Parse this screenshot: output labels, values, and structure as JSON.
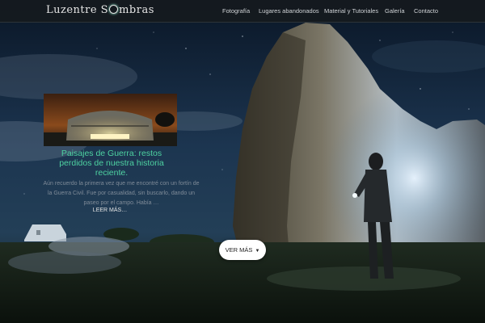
{
  "header": {
    "logo_prefix": "Luzentre S",
    "logo_suffix": "mbras",
    "nav": [
      {
        "label": "Fotografía"
      },
      {
        "label": "Lugares abandonados"
      },
      {
        "label": "Material y Tutoriales"
      },
      {
        "label": "Galería"
      },
      {
        "label": "Contacto"
      }
    ]
  },
  "featured_post": {
    "title": "Paisajes de Guerra: restos perdidos de nuestra historia reciente.",
    "excerpt": "Aún recuerdo la primera vez que me encontré con un fortín de la Guerra Civil. Fue por casualidad, sin buscarlo, dando un paseo por el campo. Había …",
    "read_more": "LEER MÁS…"
  },
  "hero": {
    "button_label": "VER MÁS",
    "button_icon": "caret-down-icon"
  },
  "colors": {
    "accent": "#4ed2a1",
    "header_bg": "#161a1e",
    "nav_text": "#cfd3d6"
  }
}
